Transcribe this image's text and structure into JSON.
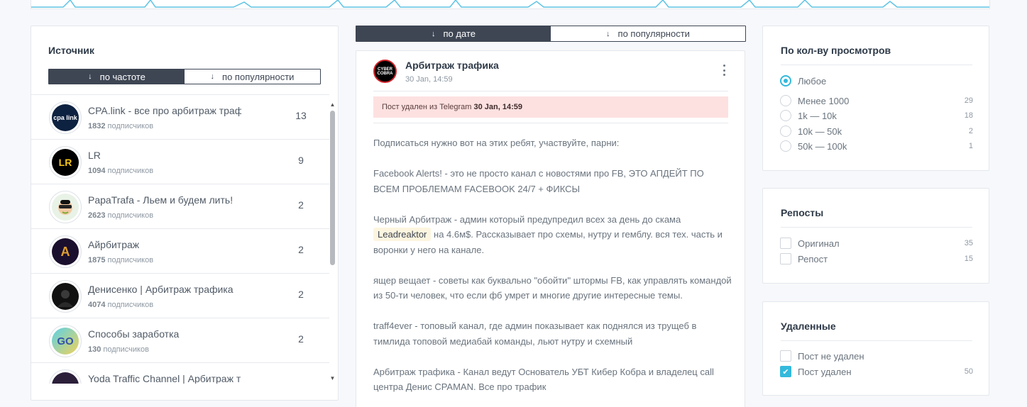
{
  "colors": {
    "accent": "#34b9dc",
    "dark": "#3e4654",
    "deleted_alert_bg": "#fde1e1"
  },
  "source": {
    "title": "Источник",
    "sort": {
      "by_frequency": "по частоте",
      "by_popularity": "по популярности",
      "active": "by_frequency"
    },
    "items": [
      {
        "name": "CPA.link - все про арбитраж трафика",
        "subs_count": "1832",
        "subs_label": "подписчиков",
        "count": "13",
        "avatar": "cpa link"
      },
      {
        "name": "LR",
        "subs_count": "1094",
        "subs_label": "подписчиков",
        "count": "9",
        "avatar": "LR"
      },
      {
        "name": "PapaTrafa - Льем и будем лить!",
        "subs_count": "2623",
        "subs_label": "подписчиков",
        "count": "2",
        "avatar": ""
      },
      {
        "name": "Айрбитраж",
        "subs_count": "1875",
        "subs_label": "подписчиков",
        "count": "2",
        "avatar": "A"
      },
      {
        "name": "Денисенко | Арбитраж трафика",
        "subs_count": "4074",
        "subs_label": "подписчиков",
        "count": "2",
        "avatar": ""
      },
      {
        "name": "Способы заработка",
        "subs_count": "130",
        "subs_label": "подписчиков",
        "count": "2",
        "avatar": "GO"
      },
      {
        "name": "Yoda Traffic Channel | Арбитраж трафика",
        "subs_count": "",
        "subs_label": "",
        "count": "",
        "avatar": ""
      }
    ]
  },
  "feed_sort": {
    "by_date": "по дате",
    "by_popularity": "по популярности",
    "active": "by_date"
  },
  "post": {
    "channel": "Арбитраж трафика",
    "avatar_text": "CYBER COBRA",
    "date": "30 Jan, 14:59",
    "alert_prefix": "Пост удален из Telegram",
    "alert_date": "30 Jan, 14:59",
    "paragraphs": {
      "p1": "Подписаться нужно вот на этих ребят, участвуйте, парни:",
      "p2": "Facebook Alerts! - это не просто канал с новостями про FB, ЭТО АПДЕЙТ ПО ВСЕМ ПРОБЛЕМАМ FACEBOOK 24/7 + ФИКСЫ",
      "p3_before": "Черный Арбитраж - админ который предупредил всех за день до скама",
      "p3_tag": "Leadreaktor",
      "p3_after": "на 4.6м$. Рассказывает про схемы, нутру и гемблу. вся тех. часть и воронки у него на канале.",
      "p4": "ящер вещает - советы как буквально \"обойти\" штормы FB, как управлять командой из 50-ти человек, что если фб умрет и многие другие интересные темы.",
      "p5": "traff4ever - топовый канал, где админ показывает как поднялся из трущеб в тимлида топовой медиабай команды, льют нутру и схемный",
      "p6": "Арбитраж трафика - Канал ведут Основатель УБТ Кибер Кобра и владелец call центра Денис CPAMAN. Все про трафик"
    }
  },
  "filters": {
    "views": {
      "title": "По кол-ву просмотров",
      "options": [
        {
          "label": "Любое",
          "count": "",
          "checked": true
        },
        {
          "label": "Менее 1000",
          "count": "29",
          "checked": false
        },
        {
          "label": "1k — 10k",
          "count": "18",
          "checked": false
        },
        {
          "label": "10k — 50k",
          "count": "2",
          "checked": false
        },
        {
          "label": "50k — 100k",
          "count": "1",
          "checked": false
        }
      ]
    },
    "reposts": {
      "title": "Репосты",
      "options": [
        {
          "label": "Оригинал",
          "count": "35",
          "checked": false
        },
        {
          "label": "Репост",
          "count": "15",
          "checked": false
        }
      ]
    },
    "deleted": {
      "title": "Удаленные",
      "options": [
        {
          "label": "Пост не удален",
          "count": "",
          "checked": false
        },
        {
          "label": "Пост удален",
          "count": "50",
          "checked": true
        }
      ]
    }
  }
}
